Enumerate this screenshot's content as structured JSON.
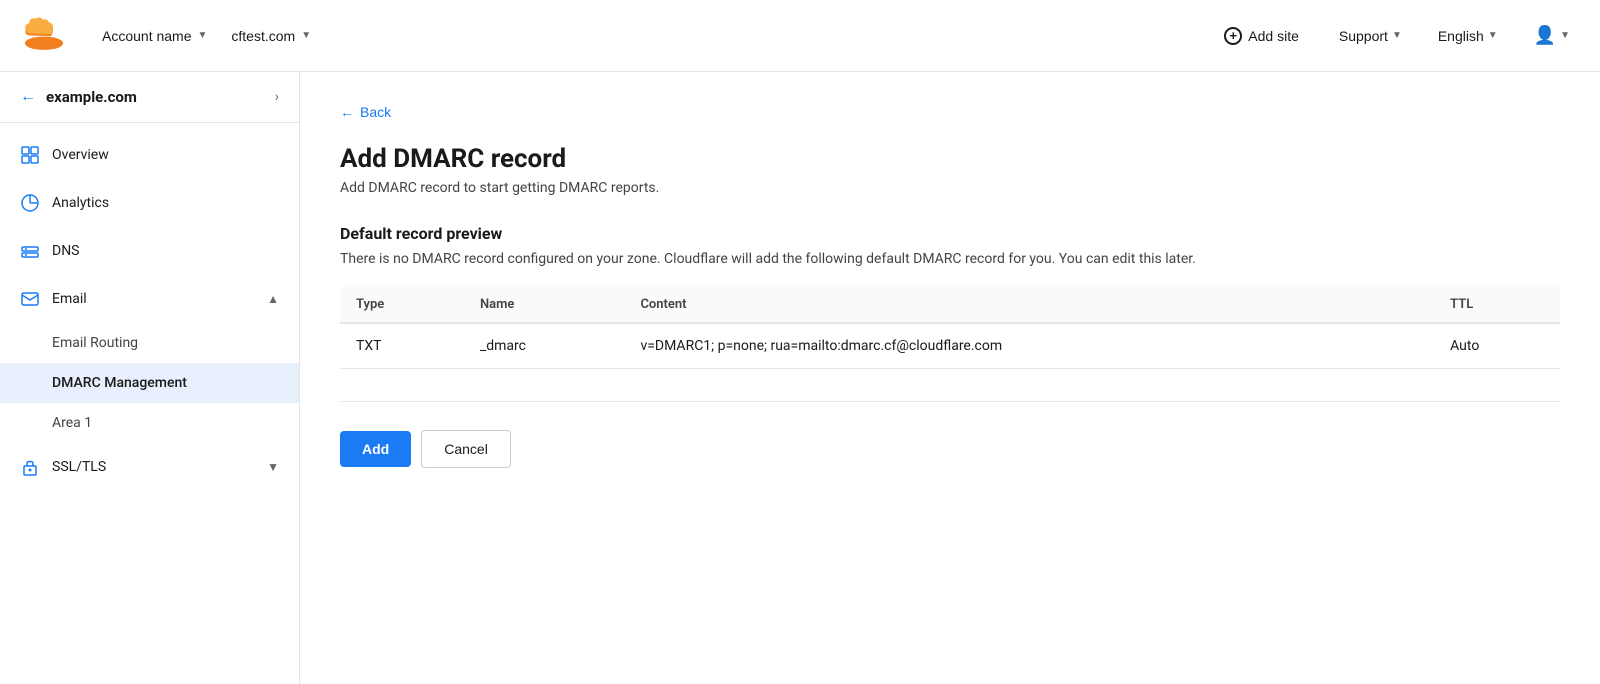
{
  "topnav": {
    "account_name": "Account name",
    "domain": "cftest.com",
    "add_site": "Add site",
    "support": "Support",
    "language": "English"
  },
  "sidebar": {
    "site_name": "example.com",
    "items": [
      {
        "id": "overview",
        "label": "Overview",
        "icon": "overview"
      },
      {
        "id": "analytics",
        "label": "Analytics",
        "icon": "analytics"
      },
      {
        "id": "dns",
        "label": "DNS",
        "icon": "dns"
      },
      {
        "id": "email",
        "label": "Email",
        "icon": "email",
        "expanded": true,
        "subitems": [
          {
            "id": "email-routing",
            "label": "Email Routing"
          },
          {
            "id": "dmarc-management",
            "label": "DMARC Management",
            "active": true
          },
          {
            "id": "area1",
            "label": "Area 1"
          }
        ]
      },
      {
        "id": "ssl-tls",
        "label": "SSL/TLS",
        "icon": "ssl"
      }
    ]
  },
  "main": {
    "back_label": "Back",
    "page_title": "Add DMARC record",
    "page_subtitle": "Add DMARC record to start getting DMARC reports.",
    "section_title": "Default record preview",
    "section_desc": "There is no DMARC record configured on your zone. Cloudflare will add the following default DMARC record for you. You can edit this later.",
    "table": {
      "columns": [
        "Type",
        "Name",
        "Content",
        "TTL"
      ],
      "rows": [
        {
          "type": "TXT",
          "name": "_dmarc",
          "content": "v=DMARC1;  p=none; rua=mailto:dmarc.cf@cloudflare.com",
          "ttl": "Auto"
        }
      ]
    },
    "add_button": "Add",
    "cancel_button": "Cancel"
  }
}
